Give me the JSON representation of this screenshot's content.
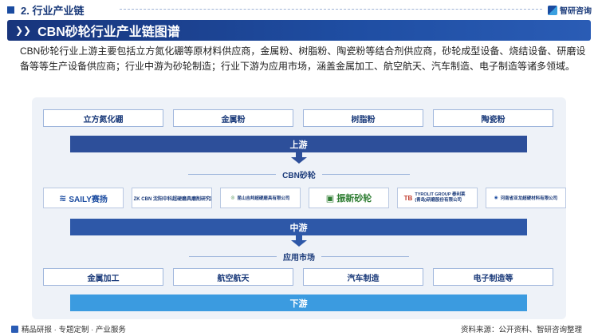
{
  "header": {
    "section": "2. 行业产业链",
    "brand": "智研咨询"
  },
  "title": "CBN砂轮行业产业链图谱",
  "description": "CBN砂轮行业上游主要包括立方氮化硼等原材料供应商，金属粉、树脂粉、陶瓷粉等结合剂供应商，砂轮成型设备、烧结设备、研磨设备等等生产设备供应商；行业中游为砂轮制造；行业下游为应用市场，涵盖金属加工、航空航天、汽车制造、电子制造等诸多领域。",
  "upstream": {
    "items": [
      "立方氮化硼",
      "金属粉",
      "树脂粉",
      "陶瓷粉"
    ],
    "band_label": "上游"
  },
  "midstream": {
    "category": "CBN砂轮",
    "companies": [
      {
        "text": "SAILY赛扬",
        "icon": "saily-logo"
      },
      {
        "text": "ZK CBN 沈阳中科超硬磨具磨削研究所",
        "icon": "zk-logo"
      },
      {
        "text": "昆山吉邦超硬磨具有限公司",
        "icon": "jibang-logo"
      },
      {
        "text": "振新砂轮",
        "icon": "zhenxin-logo"
      },
      {
        "text": "TYROLIT GROUP 泰利莱(青岛)研磨股份有限公司",
        "icon": "tyrolit-logo"
      },
      {
        "text": "河南省亚龙超硬材料有限公司",
        "icon": "yalong-logo"
      }
    ],
    "band_label": "中游"
  },
  "downstream": {
    "category": "应用市场",
    "items": [
      "金属加工",
      "航空航天",
      "汽车制造",
      "电子制造等"
    ],
    "band_label": "下游"
  },
  "footer": {
    "left": "精品研报 · 专题定制 · 产业服务",
    "right": "资料来源：公开资料、智研咨询整理"
  },
  "colors": {
    "primary": "#1a3a7a",
    "upstream_band": "#2d4f9a",
    "midstream_band": "#2e58a8",
    "downstream_band": "#3b9be0",
    "panel_bg": "#eef2f8"
  }
}
